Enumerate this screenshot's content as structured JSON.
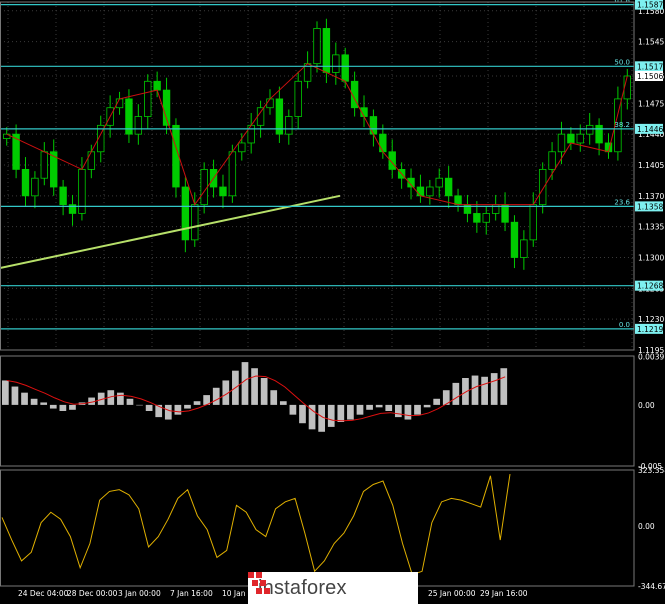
{
  "chart_data": [
    {
      "type": "candlestick",
      "panel": "price",
      "price_scale": [
        "1.1580",
        "1.1545",
        "1.1506",
        "1.1475",
        "1.1440",
        "1.1405",
        "1.1370",
        "1.1335",
        "1.1300",
        "1.1265",
        "1.1230",
        "1.1195"
      ],
      "ylim": [
        1.1195,
        1.159
      ],
      "fib_levels": [
        {
          "label": "61.8",
          "value": 1.1587,
          "tag": "1.1587"
        },
        {
          "label": "50.0",
          "value": 1.1517,
          "tag": "1.1517"
        },
        {
          "label": "38.2",
          "value": 1.1446,
          "tag": "1.1446"
        },
        {
          "label": "23.6",
          "value": 1.1358,
          "tag": "1.1358"
        },
        {
          "label": "",
          "value": 1.1268,
          "tag": "1.1268"
        },
        {
          "label": "0.0",
          "value": 1.1219,
          "tag": "1.1219"
        }
      ],
      "current_price": "1.1506",
      "closes": [
        1.144,
        1.14,
        1.137,
        1.139,
        1.142,
        1.138,
        1.136,
        1.135,
        1.14,
        1.142,
        1.145,
        1.147,
        1.148,
        1.144,
        1.146,
        1.15,
        1.149,
        1.145,
        1.138,
        1.132,
        1.136,
        1.14,
        1.138,
        1.137,
        1.142,
        1.143,
        1.145,
        1.147,
        1.148,
        1.144,
        1.146,
        1.15,
        1.152,
        1.156,
        1.151,
        1.153,
        1.15,
        1.147,
        1.146,
        1.144,
        1.142,
        1.14,
        1.139,
        1.138,
        1.137,
        1.138,
        1.139,
        1.137,
        1.136,
        1.135,
        1.134,
        1.135,
        1.136,
        1.134,
        1.13,
        1.132,
        1.136,
        1.14,
        1.142,
        1.144,
        1.143,
        1.144,
        1.145,
        1.143,
        1.142,
        1.148,
        1.1506
      ],
      "x_ticks": [
        "24 Dec 04:00",
        "28 Dec 00:00",
        "3 Jan 00:00",
        "7 Jan 16:00",
        "10 Jan",
        "25 Jan 00:00",
        "29 Jan 16:00"
      ]
    },
    {
      "type": "bar",
      "panel": "macd",
      "y_ticks": [
        "0.00397",
        "0.00",
        "-0.005"
      ],
      "ylim": [
        -0.005,
        0.004
      ],
      "values": [
        0.002,
        0.0015,
        0.001,
        0.0005,
        0.0002,
        -0.0003,
        -0.0005,
        -0.0004,
        0.0002,
        0.0006,
        0.001,
        0.0012,
        0.001,
        0.0005,
        0.0,
        -0.0005,
        -0.001,
        -0.0012,
        -0.0008,
        -0.0003,
        0.0003,
        0.0008,
        0.0014,
        0.002,
        0.0028,
        0.0035,
        0.003,
        0.0022,
        0.0012,
        0.0003,
        -0.0008,
        -0.0015,
        -0.002,
        -0.0022,
        -0.0018,
        -0.0014,
        -0.0012,
        -0.0008,
        -0.0004,
        -0.0002,
        -0.0005,
        -0.001,
        -0.0012,
        -0.0008,
        -0.0002,
        0.0005,
        0.0012,
        0.0018,
        0.0022,
        0.0024,
        0.0023,
        0.0026,
        0.003
      ]
    },
    {
      "type": "line",
      "panel": "cci",
      "y_ticks": [
        "323.3582",
        "0.00",
        "-344.6721"
      ],
      "ylim": [
        -344.6721,
        323.3582
      ],
      "values": [
        50,
        -80,
        -200,
        -150,
        20,
        80,
        40,
        -60,
        -240,
        -100,
        150,
        200,
        210,
        180,
        100,
        -120,
        -60,
        40,
        160,
        210,
        60,
        -20,
        -180,
        -140,
        120,
        80,
        -20,
        -60,
        100,
        140,
        160,
        -40,
        -260,
        -200,
        -100,
        -40,
        60,
        200,
        240,
        260,
        120,
        -100,
        -280,
        -260,
        20,
        140,
        160,
        150,
        130,
        110,
        290,
        -80,
        300
      ]
    }
  ],
  "watermark": {
    "brand": "instaforex"
  }
}
